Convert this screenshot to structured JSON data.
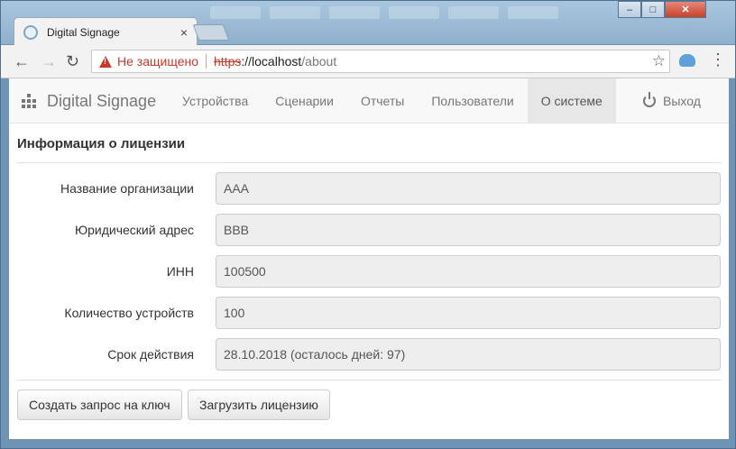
{
  "browser": {
    "tab_title": "Digital Signage",
    "tab_close": "×",
    "security_label": "Не защищено",
    "url_scheme": "https",
    "url_host": "://localhost",
    "url_path": "/about",
    "window_controls": {
      "minimize": "–",
      "maximize": "□",
      "close": "✕"
    }
  },
  "navbar": {
    "brand": "Digital Signage",
    "items": [
      {
        "label": "Устройства"
      },
      {
        "label": "Сценарии"
      },
      {
        "label": "Отчеты"
      },
      {
        "label": "Пользователи"
      },
      {
        "label": "О системе",
        "active": true
      }
    ],
    "logout_label": "Выход"
  },
  "license": {
    "title": "Информация о лицензии",
    "fields": [
      {
        "label": "Название организации",
        "value": "AAA"
      },
      {
        "label": "Юридический адрес",
        "value": "BBB"
      },
      {
        "label": "ИНН",
        "value": "100500"
      },
      {
        "label": "Количество устройств",
        "value": "100"
      },
      {
        "label": "Срок действия",
        "value": "28.10.2018 (осталось дней: 97)"
      }
    ],
    "buttons": {
      "request_key": "Создать запрос на ключ",
      "upload_license": "Загрузить лицензию"
    }
  },
  "colors": {
    "navbar_bg": "#f8f8f8",
    "active_nav_bg": "#e7e7e7",
    "insecure_red": "#c53929",
    "readonly_input_bg": "#eeeeee"
  }
}
